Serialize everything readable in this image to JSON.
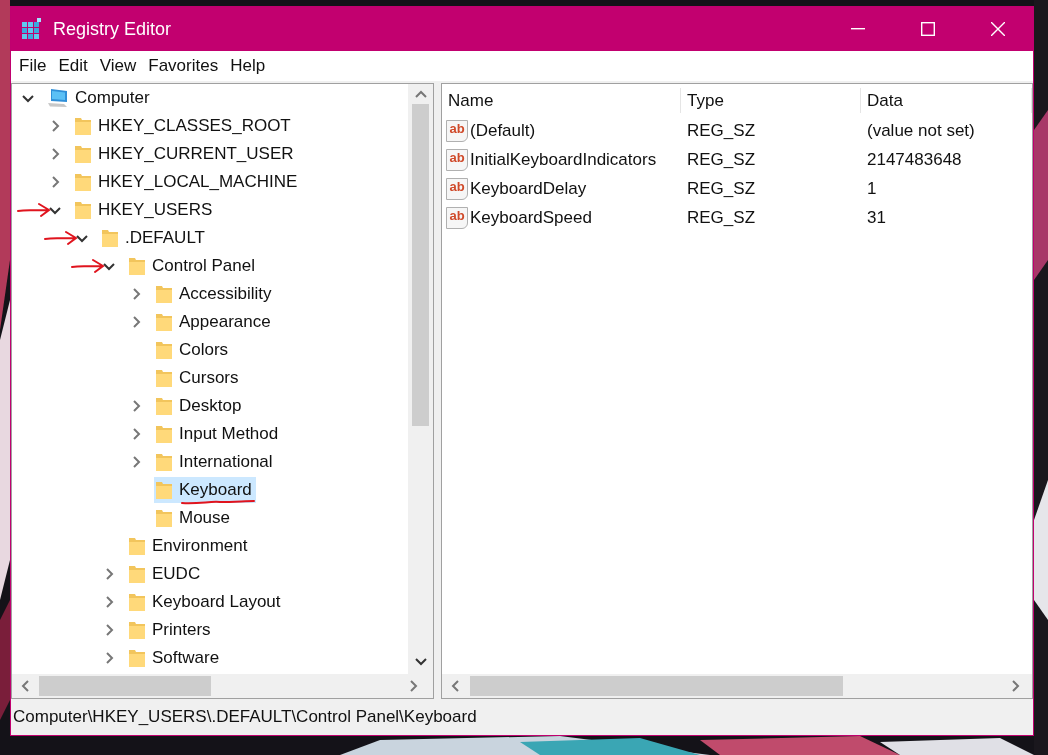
{
  "window": {
    "title": "Registry Editor"
  },
  "menu": [
    "File",
    "Edit",
    "View",
    "Favorites",
    "Help"
  ],
  "tree": {
    "label": "Computer",
    "kind": "computer",
    "has_children": true,
    "expanded": true,
    "selected": false,
    "children": [
      {
        "label": "HKEY_CLASSES_ROOT",
        "kind": "folder",
        "has_children": true,
        "expanded": false,
        "selected": false
      },
      {
        "label": "HKEY_CURRENT_USER",
        "kind": "folder",
        "has_children": true,
        "expanded": false,
        "selected": false
      },
      {
        "label": "HKEY_LOCAL_MACHINE",
        "kind": "folder",
        "has_children": true,
        "expanded": false,
        "selected": false
      },
      {
        "label": "HKEY_USERS",
        "kind": "folder",
        "has_children": true,
        "expanded": true,
        "selected": false,
        "arrow": true,
        "children": [
          {
            "label": ".DEFAULT",
            "kind": "folder",
            "has_children": true,
            "expanded": true,
            "selected": false,
            "arrow": true,
            "children": [
              {
                "label": "Control Panel",
                "kind": "folder",
                "has_children": true,
                "expanded": true,
                "selected": false,
                "arrow": true,
                "children": [
                  {
                    "label": "Accessibility",
                    "kind": "folder",
                    "has_children": true,
                    "expanded": false,
                    "selected": false
                  },
                  {
                    "label": "Appearance",
                    "kind": "folder",
                    "has_children": true,
                    "expanded": false,
                    "selected": false
                  },
                  {
                    "label": "Colors",
                    "kind": "folder",
                    "has_children": false,
                    "selected": false
                  },
                  {
                    "label": "Cursors",
                    "kind": "folder",
                    "has_children": false,
                    "selected": false
                  },
                  {
                    "label": "Desktop",
                    "kind": "folder",
                    "has_children": true,
                    "expanded": false,
                    "selected": false
                  },
                  {
                    "label": "Input Method",
                    "kind": "folder",
                    "has_children": true,
                    "expanded": false,
                    "selected": false
                  },
                  {
                    "label": "International",
                    "kind": "folder",
                    "has_children": true,
                    "expanded": false,
                    "selected": false
                  },
                  {
                    "label": "Keyboard",
                    "kind": "folder",
                    "has_children": false,
                    "selected": true,
                    "underlined": true
                  },
                  {
                    "label": "Mouse",
                    "kind": "folder",
                    "has_children": false,
                    "selected": false
                  }
                ]
              },
              {
                "label": "Environment",
                "kind": "folder",
                "has_children": false,
                "selected": false
              },
              {
                "label": "EUDC",
                "kind": "folder",
                "has_children": true,
                "expanded": false,
                "selected": false
              },
              {
                "label": "Keyboard Layout",
                "kind": "folder",
                "has_children": true,
                "expanded": false,
                "selected": false
              },
              {
                "label": "Printers",
                "kind": "folder",
                "has_children": true,
                "expanded": false,
                "selected": false
              },
              {
                "label": "Software",
                "kind": "folder",
                "has_children": true,
                "expanded": false,
                "selected": false
              }
            ]
          }
        ]
      }
    ]
  },
  "columns": [
    "Name",
    "Type",
    "Data"
  ],
  "values": [
    {
      "icon": "ab",
      "name": "(Default)",
      "type": "REG_SZ",
      "data": "(value not set)"
    },
    {
      "icon": "ab",
      "name": "InitialKeyboardIndicators",
      "type": "REG_SZ",
      "data": "2147483648"
    },
    {
      "icon": "ab",
      "name": "KeyboardDelay",
      "type": "REG_SZ",
      "data": "1"
    },
    {
      "icon": "ab",
      "name": "KeyboardSpeed",
      "type": "REG_SZ",
      "data": "31"
    }
  ],
  "status_bar": "Computer\\HKEY_USERS\\.DEFAULT\\Control Panel\\Keyboard"
}
